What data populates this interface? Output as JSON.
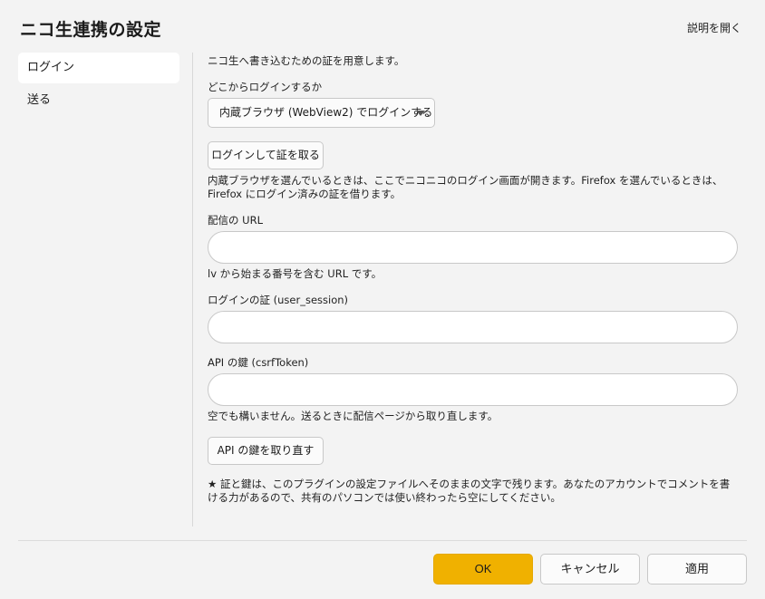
{
  "window": {
    "title": "ニコ生連携の設定",
    "help_link": "説明を開く"
  },
  "sidebar": {
    "items": [
      {
        "label": "ログイン",
        "selected": true
      },
      {
        "label": "送る",
        "selected": false
      }
    ]
  },
  "main": {
    "intro": "ニコ生へ書き込むための証を用意します。",
    "login_source_label": "どこからログインするか",
    "login_source_value": "内蔵ブラウザ (WebView2) でログインする",
    "get_cert_button": "ログインして証を取る",
    "browser_note": "内蔵ブラウザを選んでいるときは、ここでニコニコのログイン画面が開きます。Firefox を選んでいるときは、Firefox にログイン済みの証を借ります。",
    "url_label": "配信の URL",
    "url_value": "",
    "url_hint": "lv から始まる番号を含む URL です。",
    "session_label": "ログインの証 (user_session)",
    "session_value": "",
    "token_label": "API の鍵 (csrfToken)",
    "token_value": "",
    "token_hint": "空でも構いません。送るときに配信ページから取り直します。",
    "refetch_button": "API の鍵を取り直す",
    "warning": "★ 証と鍵は、このプラグインの設定ファイルへそのままの文字で残ります。あなたのアカウントでコメントを書ける力があるので、共有のパソコンでは使い終わったら空にしてください。"
  },
  "footer": {
    "ok": "OK",
    "cancel": "キャンセル",
    "apply": "適用"
  },
  "colors": {
    "accent": "#f0b100",
    "background": "#f3f3f3"
  }
}
